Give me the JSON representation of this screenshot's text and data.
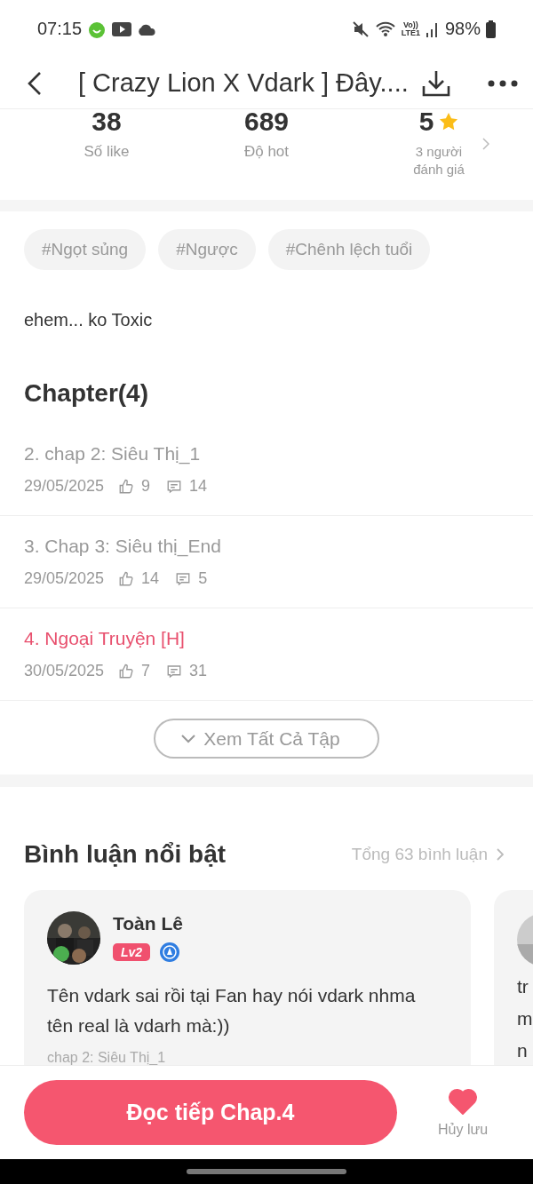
{
  "status_bar": {
    "time": "07:15",
    "volte": "Vo))",
    "lte": "LTE1",
    "battery": "98%"
  },
  "header": {
    "title": "[ Crazy Lion X Vdark ] Đây...."
  },
  "stats": [
    {
      "value": "38",
      "label": "Số like",
      "kind": "plain"
    },
    {
      "value": "689",
      "label": "Độ hot",
      "kind": "plain"
    },
    {
      "value": "5",
      "label": "3 người đánh giá",
      "kind": "rating"
    }
  ],
  "tags": [
    "#Ngọt sủng",
    "#Ngược",
    "#Chênh lệch tuổi"
  ],
  "description": "ehem... ko Toxic",
  "chapters": {
    "heading": "Chapter(4)",
    "items": [
      {
        "title": "2. chap 2: Siêu Thị_1",
        "date": "29/05/2025",
        "likes": "9",
        "comments": "14",
        "selected": false
      },
      {
        "title": "3. Chap 3: Siêu thị_End",
        "date": "29/05/2025",
        "likes": "14",
        "comments": "5",
        "selected": false
      },
      {
        "title": "4. Ngoại Truyện [H]",
        "date": "30/05/2025",
        "likes": "7",
        "comments": "31",
        "selected": true
      }
    ],
    "view_all": "Xem Tất Cả Tập"
  },
  "comments": {
    "heading": "Bình luận nổi bật",
    "total": "Tổng 63 bình luận",
    "items": [
      {
        "user": "Toàn Lê",
        "level": "Lv2",
        "text": "Tên vdark sai rồi tại Fan hay nói vdark nhma tên real là vdarh mà:))",
        "chapter": "chap 2: Siêu Thị_1"
      },
      {
        "lines": [
          "tr",
          "m",
          "n"
        ]
      }
    ]
  },
  "bottom_bar": {
    "read_button": "Đọc tiếp Chap.4",
    "save_label": "Hủy lưu",
    "saved": true
  }
}
